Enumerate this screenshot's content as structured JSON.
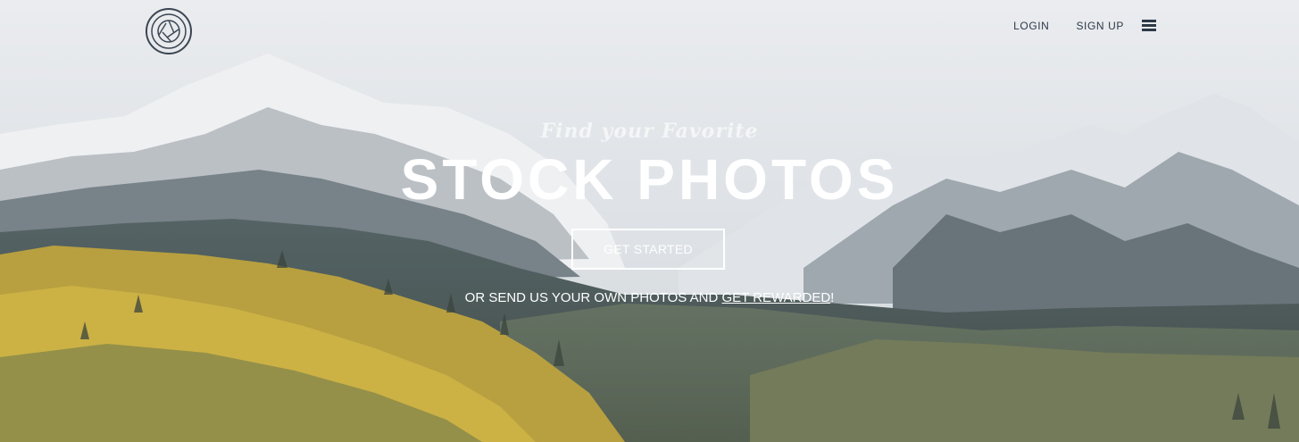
{
  "nav": {
    "login_label": "LOGIN",
    "signup_label": "SIGN UP"
  },
  "hero": {
    "kicker": "Find your Favorite",
    "headline": "STOCK PHOTOS",
    "cta_label": "GET STARTED",
    "sub_text": "OR SEND US YOUR OWN PHOTOS AND ",
    "sub_link": "GET REWARDED",
    "sub_end": "!"
  },
  "colors": {
    "nav_text": "#2c3947",
    "hero_text": "#ffffff"
  },
  "icons": {
    "logo": "camera-shutter-logo-icon",
    "menu": "hamburger-menu-icon"
  }
}
